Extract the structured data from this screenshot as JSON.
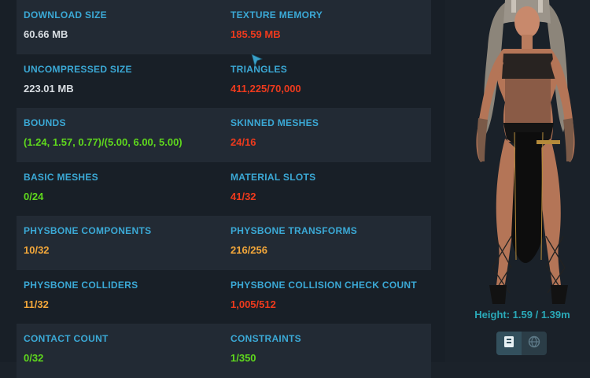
{
  "colors": {
    "label": "#3ba9d6",
    "white_value": "#d8dde2",
    "green_value": "#5fd81d",
    "red_value": "#ee3a1d",
    "orange_value": "#f3a73a",
    "height_text": "#2aa9b8"
  },
  "stats": [
    {
      "left": {
        "label": "DOWNLOAD SIZE",
        "value": "60.66 MB",
        "status": "white"
      },
      "right": {
        "label": "TEXTURE MEMORY",
        "value": "185.59 MB",
        "status": "red"
      }
    },
    {
      "left": {
        "label": "UNCOMPRESSED SIZE",
        "value": "223.01 MB",
        "status": "white"
      },
      "right": {
        "label": "TRIANGLES",
        "value": "411,225/70,000",
        "status": "red"
      }
    },
    {
      "left": {
        "label": "BOUNDS",
        "value": "(1.24, 1.57, 0.77)/(5.00, 6.00, 5.00)",
        "status": "green"
      },
      "right": {
        "label": "SKINNED MESHES",
        "value": "24/16",
        "status": "red"
      }
    },
    {
      "left": {
        "label": "BASIC MESHES",
        "value": "0/24",
        "status": "green"
      },
      "right": {
        "label": "MATERIAL SLOTS",
        "value": "41/32",
        "status": "red"
      }
    },
    {
      "left": {
        "label": "PHYSBONE COMPONENTS",
        "value": "10/32",
        "status": "orange"
      },
      "right": {
        "label": "PHYSBONE TRANSFORMS",
        "value": "216/256",
        "status": "orange"
      }
    },
    {
      "left": {
        "label": "PHYSBONE COLLIDERS",
        "value": "11/32",
        "status": "orange"
      },
      "right": {
        "label": "PHYSBONE COLLISION CHECK COUNT",
        "value": "1,005/512",
        "status": "red"
      }
    },
    {
      "left": {
        "label": "CONTACT COUNT",
        "value": "0/32",
        "status": "green"
      },
      "right": {
        "label": "CONSTRAINTS",
        "value": "1/350",
        "status": "green"
      }
    }
  ],
  "avatar": {
    "height_text": "Height: 1.59 / 1.39m"
  },
  "view_buttons": [
    {
      "icon": "book-icon",
      "active": true
    },
    {
      "icon": "globe-icon",
      "active": false
    }
  ]
}
